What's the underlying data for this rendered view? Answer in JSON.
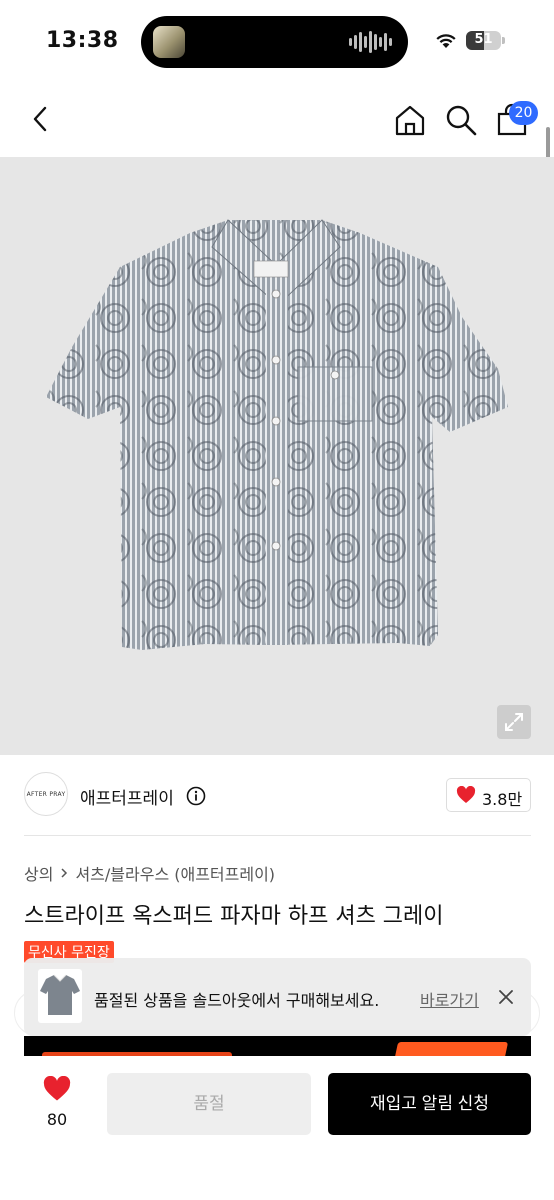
{
  "status_bar": {
    "time": "13:38",
    "battery": "51",
    "battery_level": 0.51
  },
  "nav": {
    "cart_count": "20",
    "icons": [
      "chevron-left-icon",
      "home-icon",
      "search-icon",
      "bag-icon"
    ]
  },
  "brand": {
    "logo_text": "AFTER PRAY",
    "name": "애프터프레이",
    "likes": "3.8만"
  },
  "breadcrumb": {
    "category": "상의",
    "subcategory": "셔츠/블라우스 (애프터프레이)"
  },
  "product": {
    "title": "스트라이프 옥스퍼드 파자마 하프 셔츠 그레이",
    "tag": "무신사 무진장"
  },
  "toast": {
    "message": "품절된 상품을 솔드아웃에서 구매해보세요.",
    "link": "바로가기"
  },
  "bottom": {
    "wish_count": "80",
    "soldout_label": "품절",
    "restock_label": "재입고 알림 신청"
  },
  "colors": {
    "accent_blue": "#2f6bff",
    "heart_red": "#e8222e",
    "tag_orange": "#ff4a2b",
    "primary_button": "#000000"
  }
}
